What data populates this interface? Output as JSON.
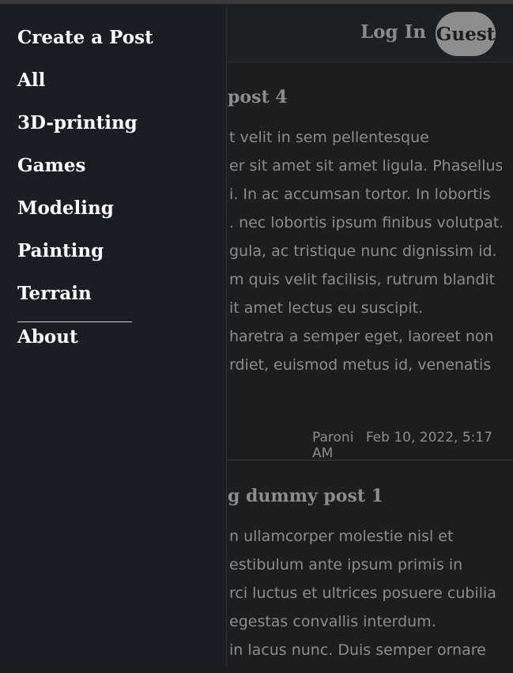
{
  "header": {
    "login_label": "Log In",
    "guest_label": "Guest"
  },
  "posts": [
    {
      "title": "post 4",
      "lines": [
        "t velit in sem pellentesque",
        "er sit amet sit amet ligula. Phasellus",
        "i. In ac accumsan tortor. In lobortis",
        ". nec lobortis ipsum finibus volutpat.",
        "gula, ac tristique nunc dignissim id.",
        "m quis velit facilisis, rutrum blandit",
        "it amet lectus eu suscipit.",
        "haretra a semper eget, laoreet non",
        "rdiet, euismod metus id, venenatis"
      ],
      "author": "Paroni",
      "date": "Feb 10, 2022, 5:17 AM"
    },
    {
      "title": "g dummy post 1",
      "lines": [
        "n ullamcorper molestie nisl et",
        "estibulum ante ipsum primis in",
        "rci luctus et ultrices posuere cubilia",
        "egestas convallis interdum.",
        "in lacus nunc. Duis semper ornare"
      ]
    }
  ],
  "sidebar": {
    "items": [
      "Create a Post",
      "All",
      "3D-printing",
      "Games",
      "Modeling",
      "Painting",
      "Terrain",
      "About"
    ]
  }
}
